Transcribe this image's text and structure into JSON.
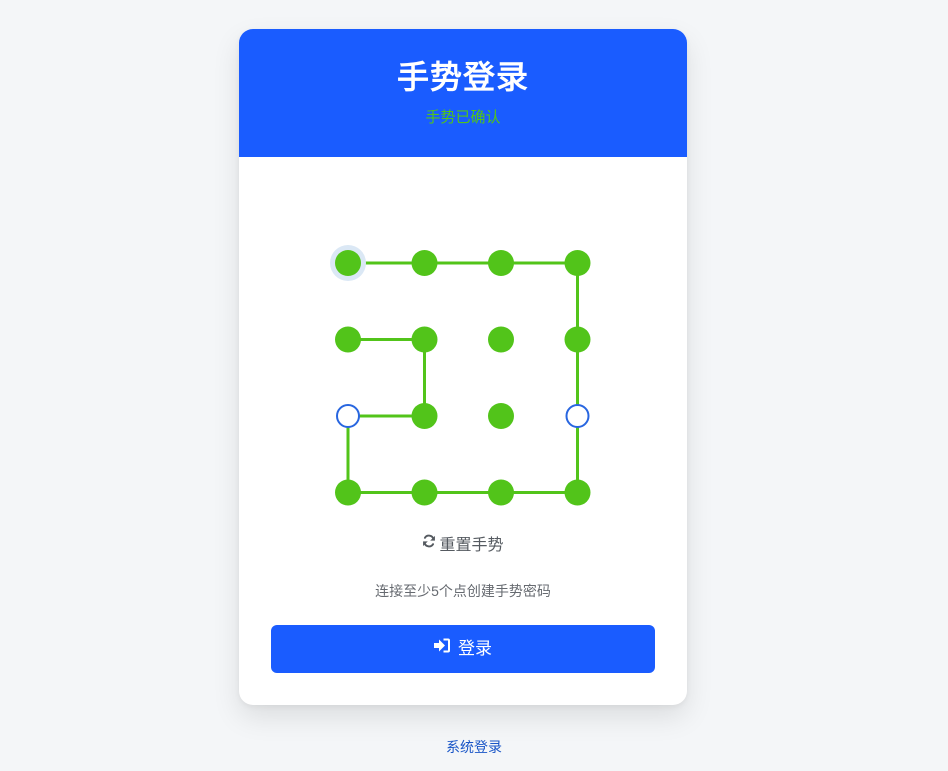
{
  "header": {
    "title": "手势登录",
    "status": "手势已确认"
  },
  "pattern": {
    "columns": 4,
    "rows": 4,
    "selected_dots": [
      1,
      2,
      3,
      4,
      5,
      6,
      7,
      8,
      10,
      11,
      13,
      14,
      15,
      16
    ],
    "unselected_dots": [
      9,
      12
    ],
    "start_dot": 1,
    "path": [
      1,
      2,
      3,
      4,
      8,
      12,
      16,
      15,
      14,
      13,
      9,
      10,
      6,
      5
    ],
    "colors": {
      "selected": "#52c41a",
      "line": "#52c41a",
      "unselected_border": "#2866e0",
      "start_halo": "#dbe8f5"
    }
  },
  "reset": {
    "icon": "refresh-icon",
    "label": "重置手势"
  },
  "hint": "连接至少5个点创建手势密码",
  "login": {
    "icon": "sign-in-icon",
    "label": "登录"
  },
  "footer": {
    "link": "系统登录"
  },
  "colors": {
    "accent": "#1a5cff",
    "background": "#f4f6f8",
    "success": "#52c41a",
    "link": "#1a56c7"
  }
}
